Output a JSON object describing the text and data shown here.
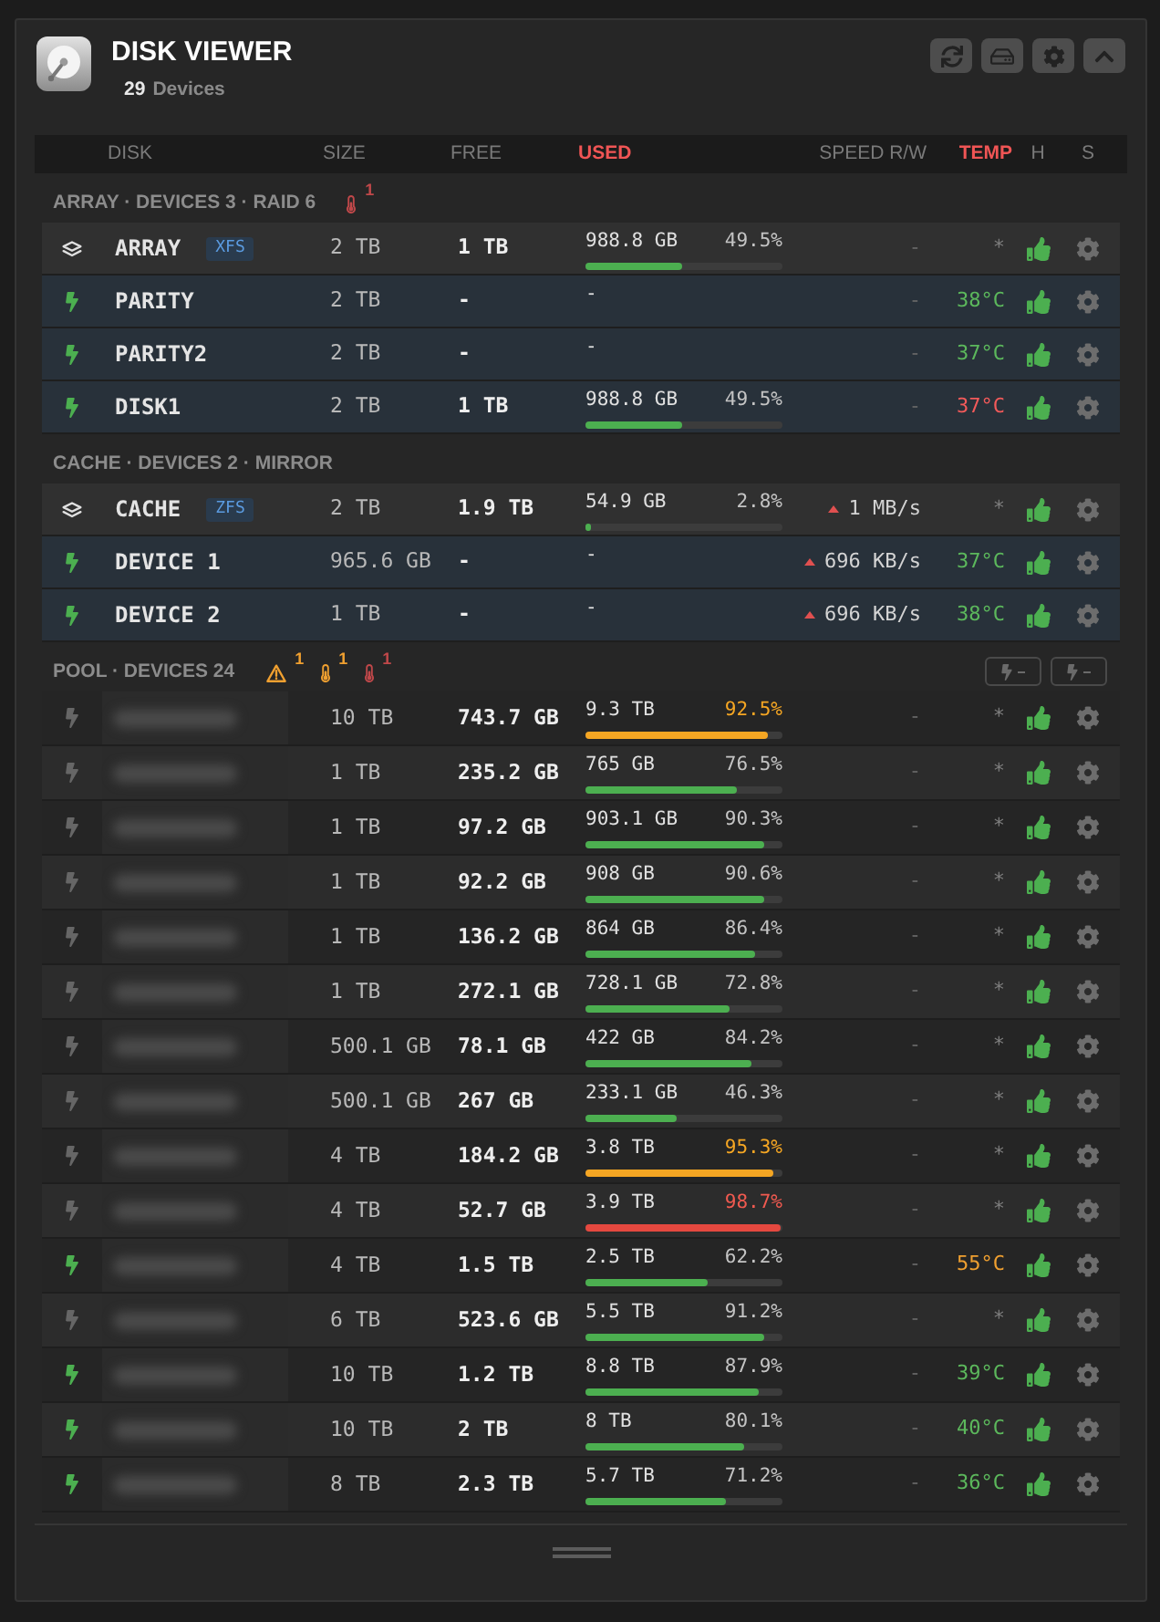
{
  "app": {
    "title": "DISK VIEWER",
    "device_count": "29",
    "device_label": "Devices"
  },
  "columns": [
    {
      "label": "DISK",
      "highlighted": false
    },
    {
      "label": "SIZE",
      "highlighted": false
    },
    {
      "label": "FREE",
      "highlighted": false
    },
    {
      "label": "USED",
      "highlighted": true
    },
    {
      "label": "SPEED R/W",
      "highlighted": false
    },
    {
      "label": "TEMP",
      "highlighted": true
    },
    {
      "label": "H",
      "highlighted": false
    },
    {
      "label": "S",
      "highlighted": false
    }
  ],
  "sections": [
    {
      "kind": "array",
      "title": "ARRAY · DEVICES 3 · RAID 6",
      "alerts": [
        {
          "kind": "temp_hot",
          "count": "1"
        }
      ],
      "rows": [
        {
          "kind": "group",
          "name": "ARRAY",
          "fs": "XFS",
          "size": "2 TB",
          "free": "1 TB",
          "used": "988.8 GB",
          "percent": "49.5%",
          "level": 0.495,
          "usage_warning": false,
          "usage_critical": false,
          "speed": "-",
          "writing": false,
          "temp": "*",
          "temp_reading": false,
          "healthy": true
        },
        {
          "kind": "disk",
          "spun_up": true,
          "name": "PARITY",
          "size": "2 TB",
          "free": "-",
          "used": "-",
          "speed": "-",
          "writing": false,
          "temp": "38°C",
          "temp_reading": true,
          "temp_warm": false,
          "temp_hot": false,
          "healthy": true
        },
        {
          "kind": "disk",
          "spun_up": true,
          "name": "PARITY2",
          "size": "2 TB",
          "free": "-",
          "used": "-",
          "speed": "-",
          "writing": false,
          "temp": "37°C",
          "temp_reading": true,
          "temp_warm": false,
          "temp_hot": false,
          "healthy": true
        },
        {
          "kind": "disk",
          "spun_up": true,
          "name": "DISK1",
          "size": "2 TB",
          "free": "1 TB",
          "used": "988.8 GB",
          "percent": "49.5%",
          "level": 0.495,
          "usage_warning": false,
          "usage_critical": false,
          "speed": "-",
          "writing": false,
          "temp": "37°C",
          "temp_reading": true,
          "temp_warm": false,
          "temp_hot": true,
          "healthy": true
        }
      ]
    },
    {
      "kind": "cache",
      "title": "CACHE · DEVICES 2 · MIRROR",
      "rows": [
        {
          "kind": "group",
          "name": "CACHE",
          "fs": "ZFS",
          "size": "2 TB",
          "free": "1.9 TB",
          "used": "54.9 GB",
          "percent": "2.8%",
          "level": 0.028,
          "usage_warning": false,
          "usage_critical": false,
          "speed": "1 MB/s",
          "writing": true,
          "temp": "*",
          "temp_reading": false,
          "healthy": true
        },
        {
          "kind": "disk",
          "spun_up": true,
          "name": "DEVICE 1",
          "size": "965.6 GB",
          "free": "-",
          "used": "-",
          "speed": "696 KB/s",
          "writing": true,
          "temp": "37°C",
          "temp_reading": true,
          "temp_warm": false,
          "temp_hot": false,
          "healthy": true
        },
        {
          "kind": "disk",
          "spun_up": true,
          "name": "DEVICE 2",
          "size": "1 TB",
          "free": "-",
          "used": "-",
          "speed": "696 KB/s",
          "writing": true,
          "temp": "38°C",
          "temp_reading": true,
          "temp_warm": false,
          "temp_hot": false,
          "healthy": true
        }
      ]
    },
    {
      "kind": "pool",
      "title": "POOL · DEVICES 24",
      "alerts": [
        {
          "kind": "warning",
          "count": "1"
        },
        {
          "kind": "temp_warm",
          "count": "1"
        },
        {
          "kind": "temp_hot",
          "count": "1"
        }
      ],
      "spin_controls": true,
      "rows": [
        {
          "kind": "disk",
          "spun_up": false,
          "size": "10 TB",
          "free": "743.7 GB",
          "used": "9.3 TB",
          "percent": "92.5%",
          "level": 0.925,
          "usage_warning": true,
          "usage_critical": false,
          "speed": "-",
          "writing": false,
          "temp": "*",
          "temp_reading": false,
          "healthy": true
        },
        {
          "kind": "disk",
          "spun_up": false,
          "size": "1 TB",
          "free": "235.2 GB",
          "used": "765 GB",
          "percent": "76.5%",
          "level": 0.765,
          "usage_warning": false,
          "usage_critical": false,
          "speed": "-",
          "writing": false,
          "temp": "*",
          "temp_reading": false,
          "healthy": true
        },
        {
          "kind": "disk",
          "spun_up": false,
          "size": "1 TB",
          "free": "97.2 GB",
          "used": "903.1 GB",
          "percent": "90.3%",
          "level": 0.903,
          "usage_warning": false,
          "usage_critical": false,
          "speed": "-",
          "writing": false,
          "temp": "*",
          "temp_reading": false,
          "healthy": true
        },
        {
          "kind": "disk",
          "spun_up": false,
          "size": "1 TB",
          "free": "92.2 GB",
          "used": "908 GB",
          "percent": "90.6%",
          "level": 0.906,
          "usage_warning": false,
          "usage_critical": false,
          "speed": "-",
          "writing": false,
          "temp": "*",
          "temp_reading": false,
          "healthy": true
        },
        {
          "kind": "disk",
          "spun_up": false,
          "size": "1 TB",
          "free": "136.2 GB",
          "used": "864 GB",
          "percent": "86.4%",
          "level": 0.864,
          "usage_warning": false,
          "usage_critical": false,
          "speed": "-",
          "writing": false,
          "temp": "*",
          "temp_reading": false,
          "healthy": true
        },
        {
          "kind": "disk",
          "spun_up": false,
          "size": "1 TB",
          "free": "272.1 GB",
          "used": "728.1 GB",
          "percent": "72.8%",
          "level": 0.728,
          "usage_warning": false,
          "usage_critical": false,
          "speed": "-",
          "writing": false,
          "temp": "*",
          "temp_reading": false,
          "healthy": true
        },
        {
          "kind": "disk",
          "spun_up": false,
          "size": "500.1 GB",
          "free": "78.1 GB",
          "used": "422 GB",
          "percent": "84.2%",
          "level": 0.842,
          "usage_warning": false,
          "usage_critical": false,
          "speed": "-",
          "writing": false,
          "temp": "*",
          "temp_reading": false,
          "healthy": true
        },
        {
          "kind": "disk",
          "spun_up": false,
          "size": "500.1 GB",
          "free": "267 GB",
          "used": "233.1 GB",
          "percent": "46.3%",
          "level": 0.463,
          "usage_warning": false,
          "usage_critical": false,
          "speed": "-",
          "writing": false,
          "temp": "*",
          "temp_reading": false,
          "healthy": true
        },
        {
          "kind": "disk",
          "spun_up": false,
          "size": "4 TB",
          "free": "184.2 GB",
          "used": "3.8 TB",
          "percent": "95.3%",
          "level": 0.953,
          "usage_warning": true,
          "usage_critical": false,
          "speed": "-",
          "writing": false,
          "temp": "*",
          "temp_reading": false,
          "healthy": true
        },
        {
          "kind": "disk",
          "spun_up": false,
          "size": "4 TB",
          "free": "52.7 GB",
          "used": "3.9 TB",
          "percent": "98.7%",
          "level": 0.987,
          "usage_warning": false,
          "usage_critical": true,
          "speed": "-",
          "writing": false,
          "temp": "*",
          "temp_reading": false,
          "healthy": true
        },
        {
          "kind": "disk",
          "spun_up": true,
          "size": "4 TB",
          "free": "1.5 TB",
          "used": "2.5 TB",
          "percent": "62.2%",
          "level": 0.622,
          "usage_warning": false,
          "usage_critical": false,
          "speed": "-",
          "writing": false,
          "temp": "55°C",
          "temp_reading": true,
          "temp_warm": true,
          "temp_hot": false,
          "healthy": true
        },
        {
          "kind": "disk",
          "spun_up": false,
          "size": "6 TB",
          "free": "523.6 GB",
          "used": "5.5 TB",
          "percent": "91.2%",
          "level": 0.912,
          "usage_warning": false,
          "usage_critical": false,
          "speed": "-",
          "writing": false,
          "temp": "*",
          "temp_reading": false,
          "healthy": true
        },
        {
          "kind": "disk",
          "spun_up": true,
          "size": "10 TB",
          "free": "1.2 TB",
          "used": "8.8 TB",
          "percent": "87.9%",
          "level": 0.879,
          "usage_warning": false,
          "usage_critical": false,
          "speed": "-",
          "writing": false,
          "temp": "39°C",
          "temp_reading": true,
          "temp_warm": false,
          "temp_hot": false,
          "healthy": true
        },
        {
          "kind": "disk",
          "spun_up": true,
          "size": "10 TB",
          "free": "2 TB",
          "used": "8 TB",
          "percent": "80.1%",
          "level": 0.801,
          "usage_warning": false,
          "usage_critical": false,
          "speed": "-",
          "writing": false,
          "temp": "40°C",
          "temp_reading": true,
          "temp_warm": false,
          "temp_hot": false,
          "healthy": true
        },
        {
          "kind": "disk",
          "spun_up": true,
          "size": "8 TB",
          "free": "2.3 TB",
          "used": "5.7 TB",
          "percent": "71.2%",
          "level": 0.712,
          "usage_warning": false,
          "usage_critical": false,
          "speed": "-",
          "writing": false,
          "temp": "36°C",
          "temp_reading": true,
          "temp_warm": false,
          "temp_hot": false,
          "healthy": true
        }
      ]
    }
  ]
}
